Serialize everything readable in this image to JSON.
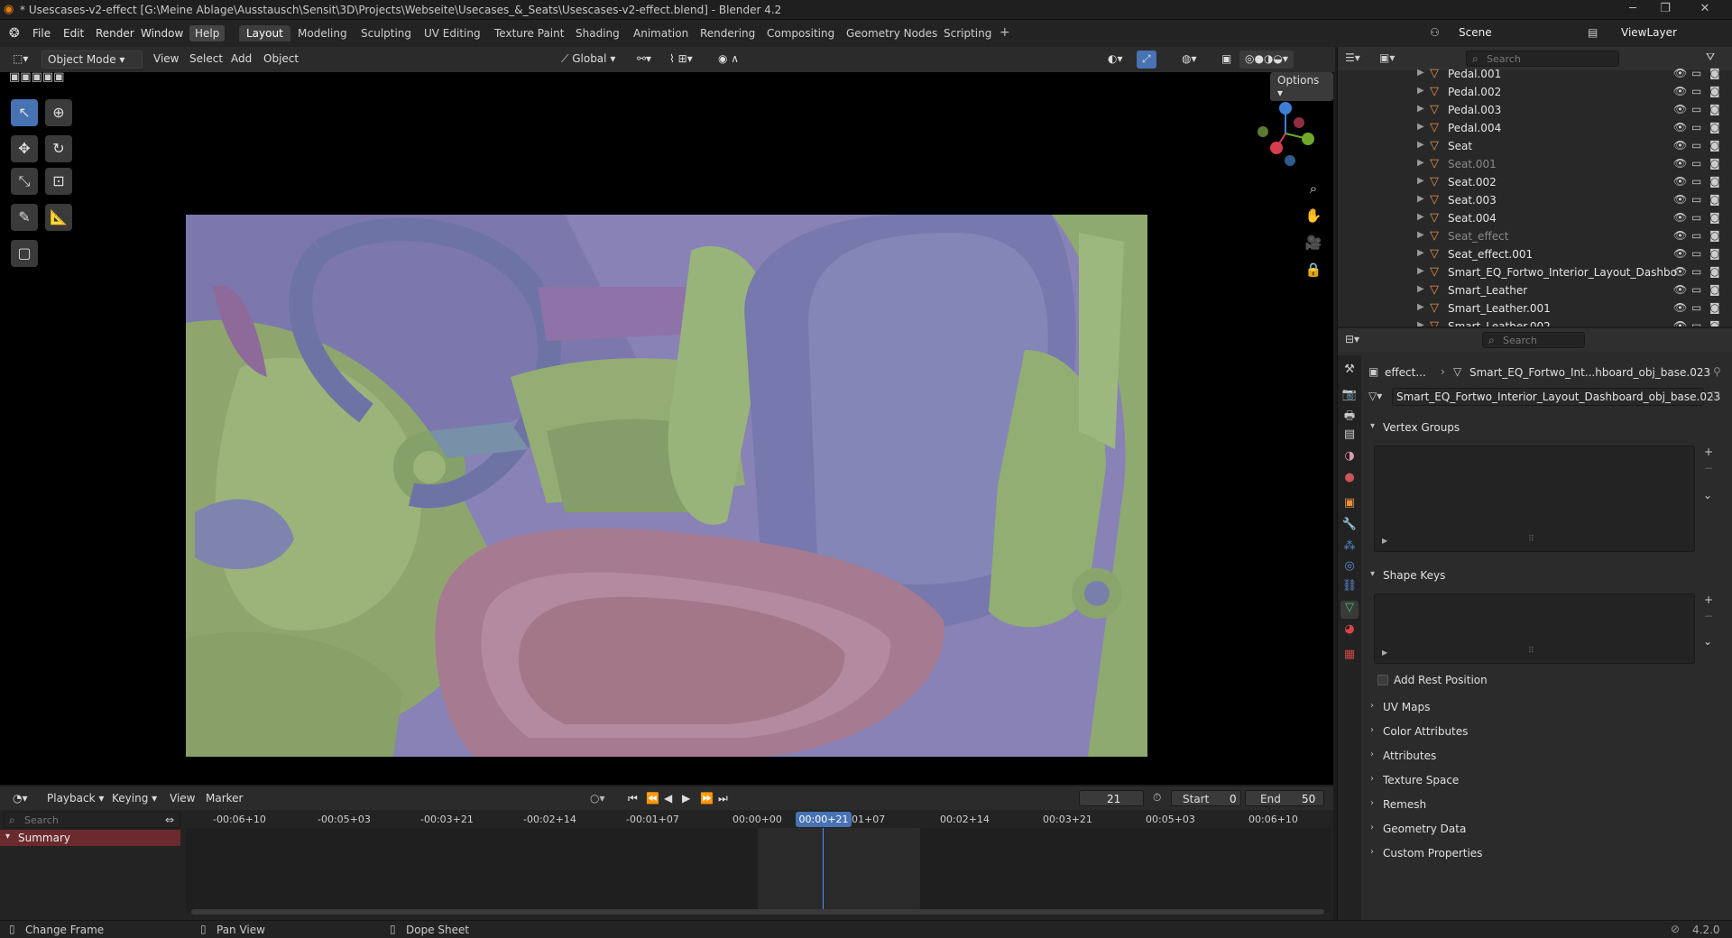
{
  "window": {
    "title": "* Usescases-v2-effect [G:\\Meine Ablage\\Ausstausch\\Sensit\\3D\\Projects\\Webseite\\Usecases_&_Seats\\Usescases-v2-effect.blend] - Blender 4.2"
  },
  "menu": {
    "items": [
      "File",
      "Edit",
      "Render",
      "Window",
      "Help"
    ]
  },
  "workspaces": [
    "Layout",
    "Modeling",
    "Sculpting",
    "UV Editing",
    "Texture Paint",
    "Shading",
    "Animation",
    "Rendering",
    "Compositing",
    "Geometry Nodes",
    "Scripting"
  ],
  "scene": {
    "name": "Scene",
    "view_layer": "ViewLayer"
  },
  "viewport_header": {
    "mode": "Object Mode",
    "menus": [
      "View",
      "Select",
      "Add",
      "Object"
    ],
    "orientation": "Global",
    "options": "Options"
  },
  "outliner": {
    "search_placeholder": "Search",
    "rows": [
      {
        "name": "Pedal.001",
        "dim": false
      },
      {
        "name": "Pedal.002",
        "dim": false
      },
      {
        "name": "Pedal.003",
        "dim": false
      },
      {
        "name": "Pedal.004",
        "dim": false
      },
      {
        "name": "Seat",
        "dim": false
      },
      {
        "name": "Seat.001",
        "dim": true
      },
      {
        "name": "Seat.002",
        "dim": false
      },
      {
        "name": "Seat.003",
        "dim": false
      },
      {
        "name": "Seat.004",
        "dim": false
      },
      {
        "name": "Seat_effect",
        "dim": true
      },
      {
        "name": "Seat_effect.001",
        "dim": false
      },
      {
        "name": "Smart_EQ_Fortwo_Interior_Layout_Dashbo",
        "dim": false
      },
      {
        "name": "Smart_Leather",
        "dim": false
      },
      {
        "name": "Smart_Leather.001",
        "dim": false
      },
      {
        "name": "Smart_Leather.002",
        "dim": false
      }
    ]
  },
  "properties": {
    "search_placeholder": "Search",
    "breadcrumb": {
      "object": "effect...",
      "data": "Smart_EQ_Fortwo_Int...hboard_obj_base.023"
    },
    "mesh_name": "Smart_EQ_Fortwo_Interior_Layout_Dashboard_obj_base.023",
    "panels": {
      "vertex_groups": "Vertex Groups",
      "shape_keys": "Shape Keys",
      "add_rest": "Add Rest Position",
      "collapsed": [
        "UV Maps",
        "Color Attributes",
        "Attributes",
        "Texture Space",
        "Remesh",
        "Geometry Data",
        "Custom Properties"
      ]
    }
  },
  "timeline": {
    "menus": [
      "Playback",
      "Keying",
      "View",
      "Marker"
    ],
    "current_frame": "21",
    "start_label": "Start",
    "start": "0",
    "end_label": "End",
    "end": "50",
    "search_placeholder": "Search",
    "summary": "Summary",
    "current_time": "00:00+21",
    "ticks": [
      "-00:06+10",
      "-00:05+03",
      "-00:03+21",
      "-00:02+14",
      "-00:01+07",
      "00:00+00",
      "01+07",
      "00:02+14",
      "00:03+21",
      "00:05+03",
      "00:06+10"
    ]
  },
  "statusbar": {
    "change_frame": "Change Frame",
    "pan_view": "Pan View",
    "dope_sheet": "Dope Sheet",
    "version": "4.2.0"
  }
}
